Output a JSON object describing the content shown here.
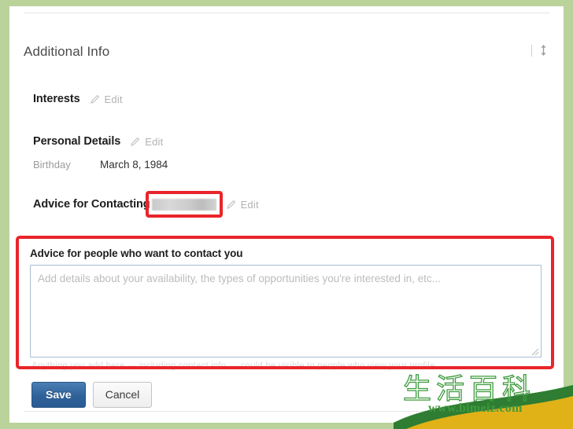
{
  "page": {
    "section_title": "Additional Info"
  },
  "header_tools": {
    "reorder_icon": "up-down-arrow-icon",
    "divider": "|"
  },
  "sections": [
    {
      "title": "Interests",
      "edit_label": "Edit",
      "edit_icon": "pencil-icon"
    },
    {
      "title": "Personal Details",
      "edit_label": "Edit",
      "edit_icon": "pencil-icon"
    },
    {
      "title": "Advice for Contacting",
      "edit_label": "Edit",
      "edit_icon": "pencil-icon"
    }
  ],
  "personal_details": {
    "birthday_label": "Birthday",
    "birthday_value": "March 8, 1984"
  },
  "advice_form": {
    "field_label": "Advice for people who want to contact you",
    "textarea_value": "",
    "textarea_placeholder": "Add details about your availability, the types of opportunities you're interested in, etc...",
    "privacy_note": "Anything you add here — including contact info — could be visible to people who view your profile.",
    "save_label": "Save",
    "cancel_label": "Cancel"
  },
  "watermark": {
    "characters": "生活百科",
    "url": "www.bimeiz.com"
  },
  "colors": {
    "page_background": "#b9d39a",
    "panel": "#ffffff",
    "highlight_red": "#e8252a",
    "save_blue": "#2f6199",
    "watermark_green": "#3f9b3f",
    "muted_text": "#9b9b9b"
  }
}
